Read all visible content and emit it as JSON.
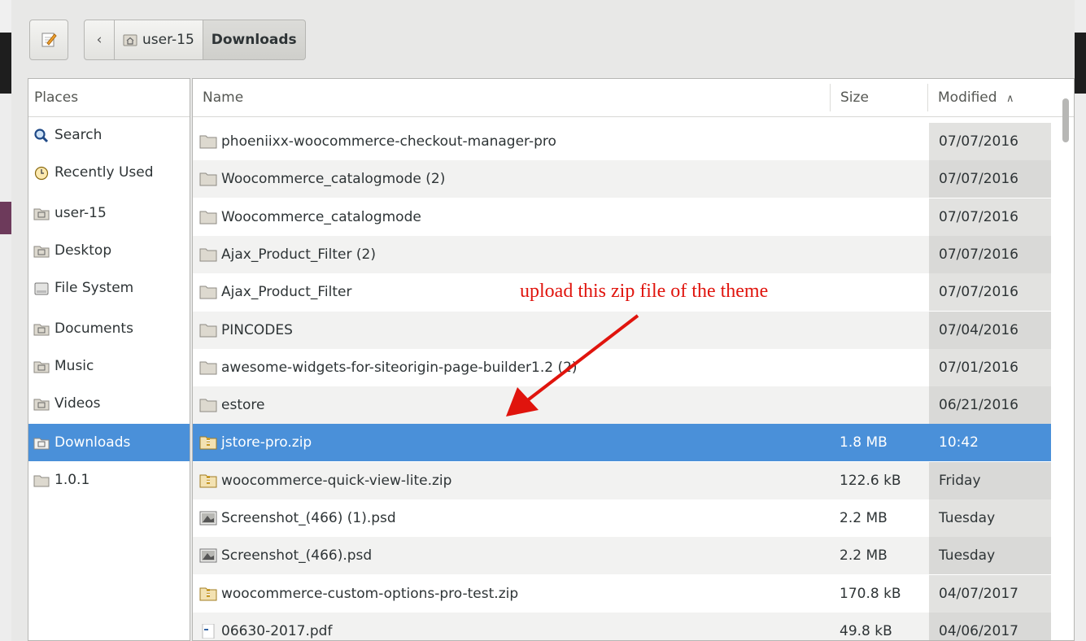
{
  "toolbar": {
    "breadcrumbs": [
      "user-15",
      "Downloads"
    ]
  },
  "places": {
    "header": "Places",
    "items": [
      {
        "label": "Search",
        "icon": "search-icon"
      },
      {
        "label": "Recently Used",
        "icon": "clock-icon"
      },
      {
        "label": "user-15",
        "icon": "home-folder-icon"
      },
      {
        "label": "Desktop",
        "icon": "desktop-folder-icon"
      },
      {
        "label": "File System",
        "icon": "drive-icon"
      },
      {
        "label": "Documents",
        "icon": "documents-folder-icon"
      },
      {
        "label": "Music",
        "icon": "music-folder-icon"
      },
      {
        "label": "Videos",
        "icon": "videos-folder-icon"
      },
      {
        "label": "Downloads",
        "icon": "downloads-folder-icon",
        "selected": true
      },
      {
        "label": "1.0.1",
        "icon": "folder-icon"
      }
    ]
  },
  "file_list": {
    "columns": {
      "name": "Name",
      "size": "Size",
      "modified": "Modified"
    },
    "rows": [
      {
        "name": "phoeniixx-woocommerce-checkout-manager-pro",
        "size": "",
        "modified": "07/07/2016",
        "type": "folder"
      },
      {
        "name": "Woocommerce_catalogmode (2)",
        "size": "",
        "modified": "07/07/2016",
        "type": "folder"
      },
      {
        "name": "Woocommerce_catalogmode",
        "size": "",
        "modified": "07/07/2016",
        "type": "folder"
      },
      {
        "name": "Ajax_Product_Filter (2)",
        "size": "",
        "modified": "07/07/2016",
        "type": "folder"
      },
      {
        "name": "Ajax_Product_Filter",
        "size": "",
        "modified": "07/07/2016",
        "type": "folder"
      },
      {
        "name": "PINCODES",
        "size": "",
        "modified": "07/04/2016",
        "type": "folder"
      },
      {
        "name": "awesome-widgets-for-siteorigin-page-builder1.2 (2)",
        "size": "",
        "modified": "07/01/2016",
        "type": "folder"
      },
      {
        "name": "estore",
        "size": "",
        "modified": "06/21/2016",
        "type": "folder"
      },
      {
        "name": "jstore-pro.zip",
        "size": "1.8 MB",
        "modified": "10:42",
        "type": "zip",
        "selected": true
      },
      {
        "name": "woocommerce-quick-view-lite.zip",
        "size": "122.6 kB",
        "modified": "Friday",
        "type": "zip"
      },
      {
        "name": "Screenshot_(466) (1).psd",
        "size": "2.2 MB",
        "modified": "Tuesday",
        "type": "image"
      },
      {
        "name": "Screenshot_(466).psd",
        "size": "2.2 MB",
        "modified": "Tuesday",
        "type": "image"
      },
      {
        "name": "woocommerce-custom-options-pro-test.zip",
        "size": "170.8 kB",
        "modified": "04/07/2017",
        "type": "zip"
      },
      {
        "name": "06630-2017.pdf",
        "size": "49.8 kB",
        "modified": "04/06/2017",
        "type": "pdf"
      }
    ]
  },
  "annotation": {
    "text": "upload this zip file of the theme",
    "color": "#e0140d"
  },
  "colors": {
    "selection": "#4a90d9",
    "folder": "#ddd9cf"
  }
}
